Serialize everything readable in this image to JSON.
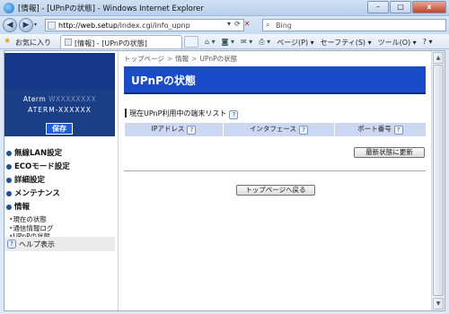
{
  "window": {
    "title": "[情報] - [UPnPの状態] - Windows Internet Explorer",
    "minimize": "–",
    "maximize": "□",
    "close": "x"
  },
  "address": {
    "back": "◀",
    "forward": "▶",
    "url_host": "http://web.setup",
    "url_path": "/index.cgi/info_upnp",
    "search_placeholder": "Bing"
  },
  "favorites": {
    "label": "お気に入り",
    "tab_label": "[情報] - [UPnPの状態]",
    "commands": [
      "ページ(P) ▾",
      "セーフティ(S) ▾",
      "ツール(O) ▾",
      "? ▾"
    ]
  },
  "sidebar": {
    "brand_name": "Aterm",
    "brand_name_masked": "WXXXXXXXX",
    "model": "ATERM-XXXXXX",
    "save_label": "保存",
    "menu": [
      {
        "label": "無線LAN設定"
      },
      {
        "label": "ECOモード設定"
      },
      {
        "label": "詳細設定"
      },
      {
        "label": "メンテナンス"
      },
      {
        "label": "情報"
      }
    ],
    "submenu": [
      "現在の状態",
      "通信情報ログ",
      "UPnPの状態"
    ],
    "help_label": "ヘルプ表示"
  },
  "main": {
    "breadcrumb": [
      "トップページ",
      "情報",
      "UPnPの状態"
    ],
    "breadcrumb_sep": ">",
    "page_title": "UPnPの状態",
    "section_title": "現在UPnP利用中の端末リスト",
    "table_headers": [
      "IPアドレス",
      "インタフェース",
      "ポート番号"
    ],
    "refresh_button": "最新状態に更新",
    "back_button": "トップページへ戻る"
  },
  "colors": {
    "page_header_bg": "#1a4cc9",
    "brand_bg": "#1b3f86",
    "table_header_bg": "#ccd7f2"
  }
}
